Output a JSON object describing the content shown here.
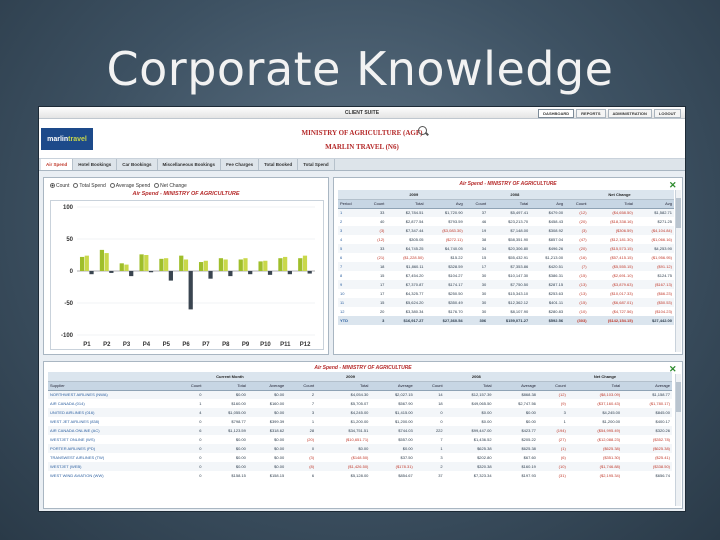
{
  "slide": {
    "title": "Corporate Knowledge"
  },
  "app": {
    "suite_title": "CLIENT SUITE",
    "menu": [
      "DASHBOARD",
      "REPORTS",
      "ADMINISTRATION",
      "LOGOUT"
    ],
    "logo": {
      "part1": "marlin",
      "part2": "travel"
    },
    "org_line1": "MINISTRY OF AGRICULTURE (AGF)",
    "org_line2": "MARLIN TRAVEL (N6)",
    "tabs": [
      "Air Spend",
      "Hotel Bookings",
      "Car Bookings",
      "Miscellaneous Bookings",
      "Fee Charges",
      "Total Booked",
      "Total Spend"
    ]
  },
  "chart_panel": {
    "radios": [
      "Count",
      "Total Spend",
      "Average Spend",
      "Net Change"
    ],
    "close_icon": "close-icon"
  },
  "chart_data": {
    "type": "bar",
    "title": "Air Spend - MINISTRY OF AGRICULTURE",
    "categories": [
      "P1",
      "P2",
      "P3",
      "P4",
      "P5",
      "P6",
      "P7",
      "P8",
      "P9",
      "P10",
      "P11",
      "P12"
    ],
    "yticks": [
      100,
      50,
      0,
      -50,
      -100
    ],
    "ylim": [
      -100,
      100
    ],
    "series": [
      {
        "color": "#9fbe2a",
        "values": [
          22,
          33,
          12,
          26,
          19,
          24,
          14,
          20,
          18,
          15,
          20,
          20
        ]
      },
      {
        "color": "#c9d84a",
        "values": [
          24,
          28,
          10,
          25,
          20,
          18,
          16,
          18,
          20,
          16,
          22,
          24
        ]
      },
      {
        "color": "#3a4550",
        "values": [
          -5,
          -3,
          -8,
          -2,
          -15,
          -60,
          -12,
          -8,
          -5,
          -6,
          -5,
          -4
        ]
      }
    ]
  },
  "table1": {
    "title": "Air Spend - MINISTRY OF AGRICULTURE",
    "groups": [
      "2009",
      "2008",
      "Net Change"
    ],
    "columns": [
      "Period",
      "Count",
      "Total",
      "Avg",
      "Count",
      "Total",
      "Avg",
      "Count",
      "Total",
      "Avg"
    ],
    "rows": [
      [
        "1",
        "33",
        "$2,784.51",
        "$1,720.90",
        "37",
        "$5,497.41",
        "$479.00",
        "(12)",
        "($4,658.50)",
        "$1,582.71"
      ],
      [
        "2",
        "40",
        "$2,877.54",
        "$793.59",
        "46",
        "$23,213.70",
        "$458.43",
        "(20)",
        "($18,338.16)",
        "$271.25"
      ],
      [
        "3",
        "(3)",
        "$7,347.44",
        "($3,083.30)",
        "19",
        "$7,148.00",
        "$308.92",
        "(3)",
        "($306.59)",
        "($4,104.84)"
      ],
      [
        "4",
        "(12)",
        "$305.05",
        "($272.11)",
        "38",
        "$58,351.90",
        "$857.04",
        "(47)",
        "($12,181.30)",
        "($1,066.16)"
      ],
      [
        "5",
        "33",
        "$4,745.25",
        "$4,740.05",
        "34",
        "$20,306.80",
        "$496.26",
        "(20)",
        "($15,573.15)",
        "$4,253.90"
      ],
      [
        "6",
        "(21)",
        "($1,228.50)",
        "$15.22",
        "15",
        "$55,432.91",
        "$1,213.00",
        "(16)",
        "($57,415.15)",
        "($1,956.95)"
      ],
      [
        "7",
        "18",
        "$1,860.11",
        "$328.59",
        "17",
        "$7,353.86",
        "$420.51",
        "(7)",
        "($5,555.15)",
        "($91.12)"
      ],
      [
        "8",
        "15",
        "$7,454.20",
        "$104.27",
        "30",
        "$10,147.30",
        "$386.31",
        "(15)",
        "($2,691.10)",
        "$124.75"
      ],
      [
        "9",
        "17",
        "$7,370.87",
        "$174.17",
        "30",
        "$7,750.50",
        "$287.15",
        "(13)",
        "($3,879.63)",
        "($167.13)"
      ],
      [
        "10",
        "17",
        "$4,325.77",
        "$250.50",
        "30",
        "$15,343.10",
        "$253.63",
        "(13)",
        "($10,017.33)",
        "($66.23)"
      ],
      [
        "11",
        "15",
        "$5,624.20",
        "$350.49",
        "30",
        "$12,362.12",
        "$401.11",
        "(15)",
        "($6,687.01)",
        "($50.53)"
      ],
      [
        "12",
        "20",
        "$3,380.34",
        "$176.70",
        "30",
        "$8,107.90",
        "$280.83",
        "(10)",
        "($4,727.56)",
        "($104.23)"
      ],
      [
        "YTD",
        "3",
        "$16,917.27",
        "$27,360.54",
        "306",
        "$159,071.27",
        "$592.56",
        "(303)",
        "($142,154.15)",
        "$27,442.00"
      ]
    ]
  },
  "table2": {
    "title": "Air Spend - MINISTRY OF AGRICULTURE",
    "groups": [
      "Current Month",
      "2009",
      "2008",
      "Net Change"
    ],
    "columns": [
      "Supplier",
      "Count",
      "Total",
      "Average",
      "Count",
      "Total",
      "Average",
      "Count",
      "Total",
      "Average",
      "Count",
      "Total",
      "Average"
    ],
    "rows": [
      [
        "NORTHWEST AIRLINES (NWA)",
        "0",
        "$0.00",
        "$0.00",
        "2",
        "$4,054.30",
        "$2,027.15",
        "14",
        "$12,157.39",
        "$868.38",
        "(12)",
        "($8,103.09)",
        "$1,158.77"
      ],
      [
        "AIR CANADA (014)",
        "1",
        "$160.00",
        "$160.00",
        "7",
        "$5,705.07",
        "$567.90",
        "18",
        "$49,065.50",
        "$2,747.56",
        "(9)",
        "($37,160.43)",
        "($1,780.17)"
      ],
      [
        "UNITED AIRLINES (016)",
        "4",
        "$1,055.00",
        "$0.00",
        "3",
        "$4,245.00",
        "$1,415.00",
        "0",
        "$0.00",
        "$0.00",
        "3",
        "$4,245.00",
        "$845.00"
      ],
      [
        "WEST JET AIRLINES (838)",
        "0",
        "$798.77",
        "$399.39",
        "1",
        "$1,200.00",
        "$1,200.00",
        "0",
        "$0.00",
        "$0.00",
        "1",
        "$1,200.00",
        "$400.17"
      ],
      [
        "AIR CANADA ONLINE (AC)",
        "6",
        "$1,123.59",
        "$318.62",
        "28",
        "$34,751.51",
        "$744.03",
        "222",
        "$99,447.00",
        "$423.77",
        "(194)",
        "($54,995.49)",
        "$320.26"
      ],
      [
        "WESTJET ONLINE (WS)",
        "0",
        "$0.00",
        "$0.00",
        "(20)",
        "($10,651.71)",
        "$557.00",
        "7",
        "$1,436.52",
        "$205.22",
        "(27)",
        "($12,088.23)",
        "($352.78)"
      ],
      [
        "PORTER AIRLINES (PD)",
        "0",
        "$0.00",
        "$0.00",
        "0",
        "$0.00",
        "$0.00",
        "1",
        "$625.38",
        "$625.38",
        "(1)",
        "($625.38)",
        "($625.38)"
      ],
      [
        "TRANSWEST AIRLINES (TW)",
        "0",
        "$0.00",
        "$0.00",
        "(3)",
        "($148.50)",
        "$37.50",
        "3",
        "$202.80",
        "$67.60",
        "(6)",
        "($351.30)",
        "($25.41)"
      ],
      [
        "WESTJET (WEB)",
        "0",
        "$0.00",
        "$0.00",
        "(8)",
        "($1,426.50)",
        "($178.31)",
        "2",
        "$320.38",
        "$160.19",
        "(10)",
        "($1,746.88)",
        "($338.50)"
      ],
      [
        "WEST WIND AVIATION (WW)",
        "0",
        "$158.15",
        "$158.15",
        "6",
        "$5,128.00",
        "$854.67",
        "37",
        "$7,323.34",
        "$197.93",
        "(31)",
        "($2,195.34)",
        "$656.74"
      ]
    ]
  }
}
